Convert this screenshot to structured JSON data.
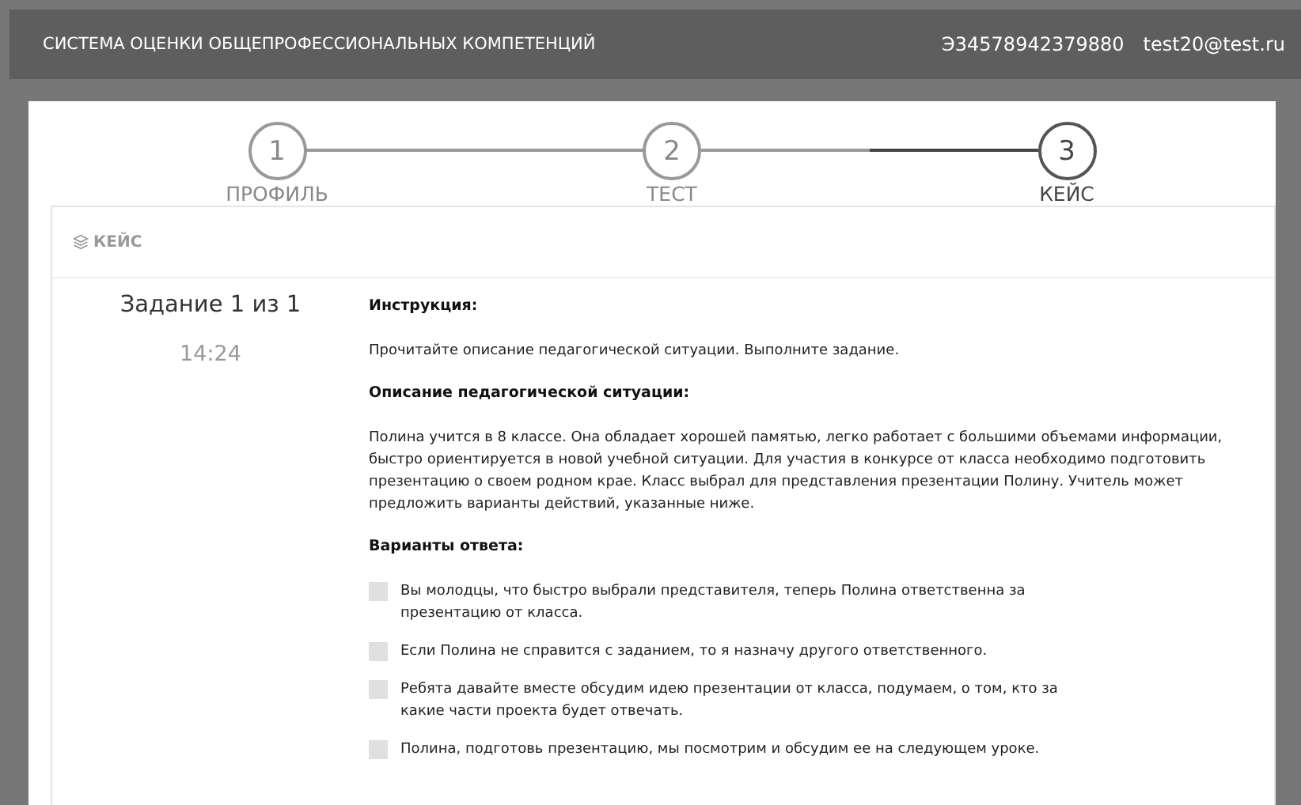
{
  "header": {
    "title": "СИСТЕМА ОЦЕНКИ ОБЩЕПРОФЕССИОНАЛЬНЫХ КОМПЕТЕНЦИЙ",
    "user_id": "Э34578942379880",
    "email": "test20@test.ru"
  },
  "steps": [
    {
      "number": "1",
      "label": "ПРОФИЛЬ",
      "selected": false
    },
    {
      "number": "2",
      "label": "ТЕСТ",
      "selected": false
    },
    {
      "number": "3",
      "label": "КЕЙС",
      "selected": true
    }
  ],
  "card": {
    "title": "КЕЙС",
    "task": "Задание 1 из 1",
    "timer": "14:24",
    "sections": [
      {
        "kind": "heading",
        "text": "Инструкция:"
      },
      {
        "kind": "paragraph",
        "text": "Прочитайте описание педагогической ситуации. Выполните задание."
      },
      {
        "kind": "heading",
        "text": "Описание педагогической ситуации:"
      },
      {
        "kind": "paragraph",
        "text": "Полина учится в 8 классе. Она обладает хорошей памятью, легко работает с большими объемами информации, быстро ориентируется в новой учебной ситуации. Для участия в конкурсе от класса необходимо подготовить презентацию о своем родном крае. Класс выбрал для представления презентации Полину. Учитель может предложить варианты действий, указанные ниже."
      },
      {
        "kind": "heading",
        "text": "Варианты ответа:"
      }
    ],
    "options": [
      {
        "text": "Вы молодцы, что быстро выбрали представителя, теперь Полина ответственна за презентацию от класса.",
        "checked": false
      },
      {
        "text": "Если Полина не справится с заданием, то я назначу другого ответственного.",
        "checked": false
      },
      {
        "text": "Ребята давайте вместе обсудим идею презентации от класса, подумаем, о том, кто за какие части проекта будет отвечать.",
        "checked": false
      },
      {
        "text": "Полина, подготовь презентацию, мы посмотрим и обсудим ее на следующем уроке.",
        "checked": false
      }
    ]
  }
}
